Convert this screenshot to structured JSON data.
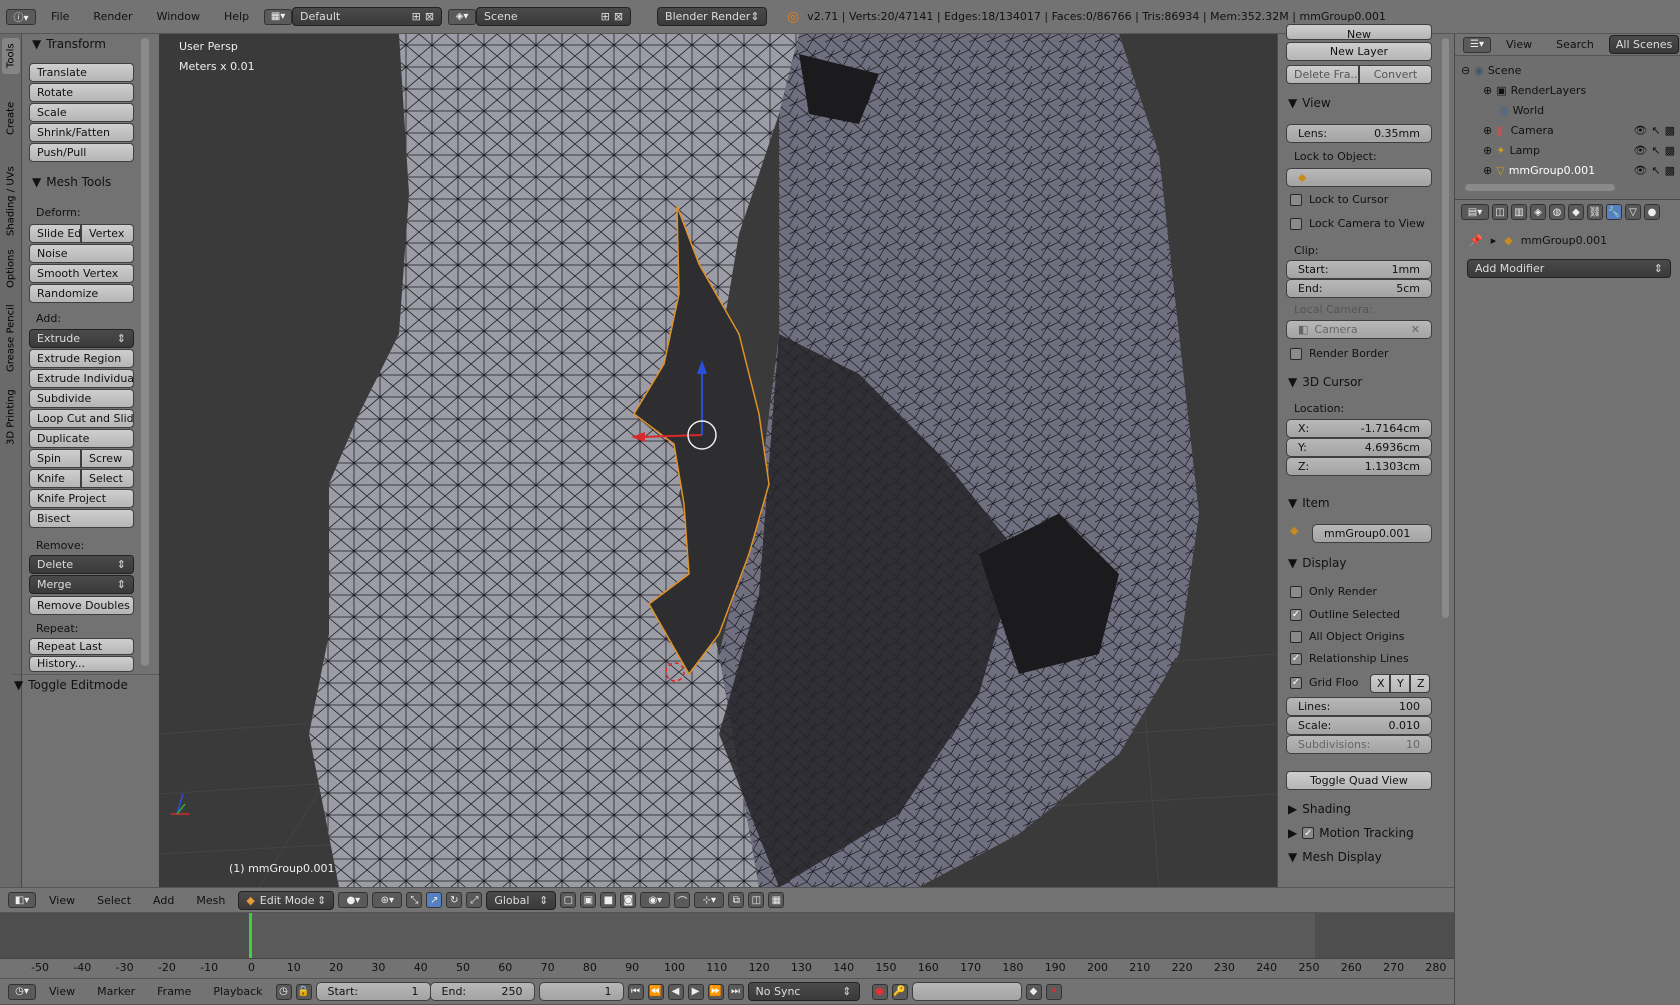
{
  "topbar": {
    "menus": [
      "File",
      "Render",
      "Window",
      "Help"
    ],
    "screen_layout": "Default",
    "scene": "Scene",
    "engine": "Blender Render",
    "stats": "v2.71 | Verts:20/47141 | Edges:18/134017 | Faces:0/86766 | Tris:86934 | Mem:352.32M | mmGroup0.001"
  },
  "tool_tabs": [
    "Tools",
    "Create",
    "Shading / UVs",
    "Options",
    "Grease Pencil",
    "3D Printing"
  ],
  "tools": {
    "transform_title": "Transform",
    "transform": [
      "Translate",
      "Rotate",
      "Scale",
      "Shrink/Fatten",
      "Push/Pull"
    ],
    "mesh_tools_title": "Mesh Tools",
    "deform_label": "Deform:",
    "slide_edge": "Slide Ed",
    "vertex": "Vertex",
    "noise": "Noise",
    "smooth_vertex": "Smooth Vertex",
    "randomize": "Randomize",
    "add_label": "Add:",
    "extrude": "Extrude",
    "extrude_region": "Extrude Region",
    "extrude_individual": "Extrude Individual",
    "subdivide": "Subdivide",
    "loop_cut": "Loop Cut and Slide",
    "duplicate": "Duplicate",
    "spin": "Spin",
    "screw": "Screw",
    "knife": "Knife",
    "select": "Select",
    "knife_project": "Knife Project",
    "bisect": "Bisect",
    "remove_label": "Remove:",
    "delete": "Delete",
    "merge": "Merge",
    "remove_doubles": "Remove Doubles",
    "repeat_label": "Repeat:",
    "repeat_last": "Repeat Last",
    "history": "History...",
    "toggle_editmode": "Toggle Editmode"
  },
  "viewport": {
    "view_name": "User Persp",
    "units": "Meters x 0.01",
    "object_label": "(1) mmGroup0.001"
  },
  "properties_panel": {
    "new_top": "New",
    "new_layer": "New Layer",
    "delete_frame": "Delete Fra...",
    "convert": "Convert",
    "view_title": "View",
    "lens_label": "Lens:",
    "lens_value": "0.35mm",
    "lock_to_object": "Lock to Object:",
    "lock_to_cursor": "Lock to Cursor",
    "lock_camera": "Lock Camera to View",
    "clip_label": "Clip:",
    "clip_start_label": "Start:",
    "clip_start": "1mm",
    "clip_end_label": "End:",
    "clip_end": "5cm",
    "local_camera": "Local Camera:",
    "camera": "Camera",
    "render_border": "Render Border",
    "cursor_title": "3D Cursor",
    "location_label": "Location:",
    "x_label": "X:",
    "x": "-1.7164cm",
    "y_label": "Y:",
    "y": "4.6936cm",
    "z_label": "Z:",
    "z": "1.1303cm",
    "item_title": "Item",
    "item_name": "mmGroup0.001",
    "display_title": "Display",
    "only_render": "Only Render",
    "outline_selected": "Outline Selected",
    "all_object_origins": "All Object Origins",
    "relationship_lines": "Relationship Lines",
    "grid_floor": "Grid Floo",
    "axis_x": "X",
    "axis_y": "Y",
    "axis_z": "Z",
    "lines_label": "Lines:",
    "lines": "100",
    "scale_label": "Scale:",
    "scale": "0.010",
    "subdiv_label": "Subdivisions:",
    "subdiv": "10",
    "toggle_quad": "Toggle Quad View",
    "shading": "Shading",
    "motion_tracking": "Motion Tracking",
    "mesh_display": "Mesh Display"
  },
  "outliner": {
    "view": "View",
    "search": "Search",
    "all_scenes": "All Scenes",
    "items": [
      "Scene",
      "RenderLayers",
      "World",
      "Camera",
      "Lamp",
      "mmGroup0.001"
    ]
  },
  "modifiers": {
    "object_name": "mmGroup0.001",
    "add_modifier": "Add Modifier"
  },
  "viewport_header": {
    "menus": [
      "View",
      "Select",
      "Add",
      "Mesh"
    ],
    "mode": "Edit Mode",
    "orientation": "Global"
  },
  "timeline": {
    "ticks": [
      "-50",
      "-40",
      "-30",
      "-20",
      "-10",
      "0",
      "10",
      "20",
      "30",
      "40",
      "50",
      "60",
      "70",
      "80",
      "90",
      "100",
      "110",
      "120",
      "130",
      "140",
      "150",
      "160",
      "170",
      "180",
      "190",
      "200",
      "210",
      "220",
      "230",
      "240",
      "250",
      "260",
      "270",
      "280"
    ],
    "menus": [
      "View",
      "Marker",
      "Frame",
      "Playback"
    ],
    "start_label": "Start:",
    "start": "1",
    "end_label": "End:",
    "end": "250",
    "current": "1",
    "sync": "No Sync"
  }
}
